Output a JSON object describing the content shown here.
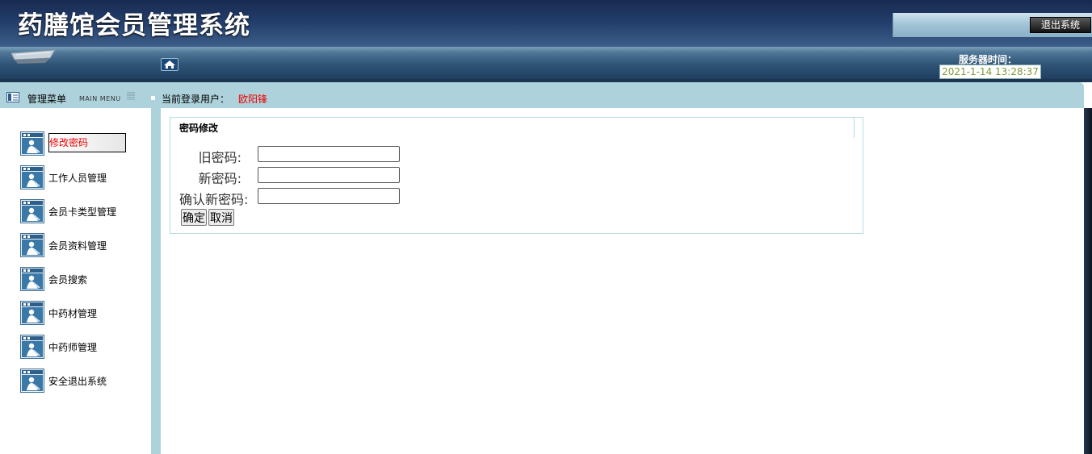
{
  "app_title": "药膳馆会员管理系统",
  "header": {
    "logout_label": "退出系统",
    "server_time_label": "服务器时间：",
    "server_time_value": "2021-1-14 13:28:37"
  },
  "subbar": {
    "menu_title": "管理菜单",
    "menu_subtitle": "MAIN MENU",
    "login_label": "当前登录用户：",
    "login_user": "欧阳锋"
  },
  "sidebar": {
    "items": [
      {
        "label": "修改密码",
        "active": true
      },
      {
        "label": "工作人员管理"
      },
      {
        "label": "会员卡类型管理"
      },
      {
        "label": "会员资料管理"
      },
      {
        "label": "会员搜索"
      },
      {
        "label": "中药材管理"
      },
      {
        "label": "中药师管理"
      },
      {
        "label": "安全退出系统"
      }
    ]
  },
  "form": {
    "title": "密码修改",
    "old_password_label": "旧密码:",
    "new_password_label": "新密码:",
    "confirm_password_label": "确认新密码:",
    "old_password_value": "",
    "new_password_value": "",
    "confirm_password_value": "",
    "submit_label": "确定",
    "cancel_label": "取消"
  },
  "colors": {
    "accent_red": "#e00000",
    "subbar_bg": "#aed2db",
    "header_dark": "#1a2d52"
  }
}
